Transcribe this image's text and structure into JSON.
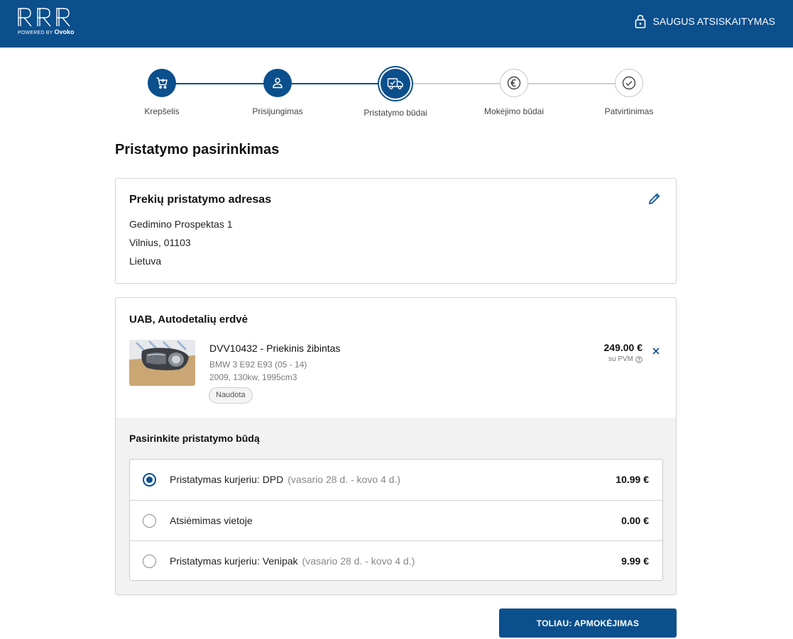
{
  "header": {
    "logo_text": "RRR",
    "logo_powered": "POWERED BY",
    "logo_brand": "Ovoko",
    "secure_label": "SAUGUS ATSISKAITYMAS"
  },
  "colors": {
    "primary": "#0b4f8d",
    "background": "#ffffff",
    "panel": "#f2f2f2"
  },
  "steps": [
    {
      "label": "Krepšelis",
      "icon": "cart-icon",
      "state": "done"
    },
    {
      "label": "Prisijungimas",
      "icon": "user-icon",
      "state": "done"
    },
    {
      "label": "Pristatymo būdai",
      "icon": "truck-icon",
      "state": "active"
    },
    {
      "label": "Mokėjimo būdai",
      "icon": "euro-icon",
      "state": "todo"
    },
    {
      "label": "Patvirtinimas",
      "icon": "check-icon",
      "state": "todo"
    }
  ],
  "page_title": "Pristatymo pasirinkimas",
  "address": {
    "heading": "Prekių pristatymo adresas",
    "lines": [
      "Gedimino Prospektas 1",
      "Vilnius, 01103",
      "Lietuva"
    ]
  },
  "order": {
    "seller": "UAB, Autodetalių erdvė",
    "product": {
      "name": "DVV10432 - Priekinis žibintas",
      "model": "BMW 3 E92 E93 (05 - 14)",
      "specs": "2009, 130kw, 1995cm3",
      "condition": "Naudota",
      "price": "249.00 €",
      "price_note": "su PVM"
    },
    "shipping_heading": "Pasirinkite pristatymo būdą",
    "shipping_options": [
      {
        "name": "Pristatymas kurjeriu: DPD",
        "dates": "(vasario 28 d. - kovo 4 d.)",
        "price": "10.99 €",
        "selected": true
      },
      {
        "name": "Atsiėmimas vietoje",
        "dates": "",
        "price": "0.00 €",
        "selected": false
      },
      {
        "name": "Pristatymas kurjeriu: Venipak",
        "dates": "(vasario 28 d. - kovo 4 d.)",
        "price": "9.99 €",
        "selected": false
      }
    ]
  },
  "next_button": "TOLIAU: APMOKĖJIMAS"
}
